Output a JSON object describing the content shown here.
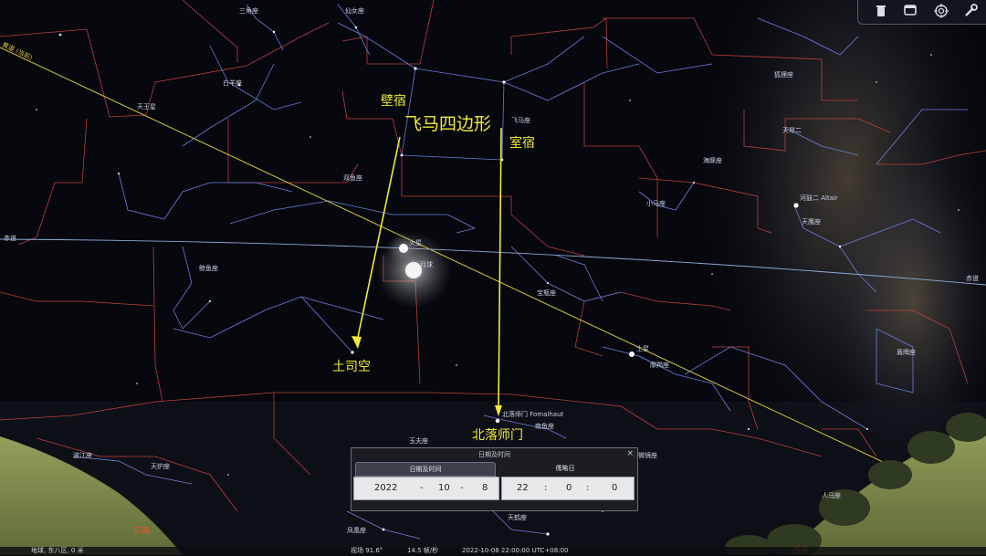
{
  "constellations": {
    "sanjiao": "三角座",
    "xiannv": "仙女座",
    "baiyang": "白羊座",
    "tianwang": "天王星",
    "shuangyu": "双鱼座",
    "jingyu": "鲸鱼座",
    "feima": "飞马座",
    "hutu": "狐狸座",
    "tianqin": "天琴二",
    "haitun": "海豚座",
    "xiaoma": "小马座",
    "altair": "河鼓二 Altair",
    "tianying": "天鹰座",
    "huoxing": "火星",
    "yueqiu": "月球",
    "baoping": "宝瓶座",
    "tuxing": "土星",
    "mojie": "摩羯座",
    "dunpai": "盾牌座",
    "fomalhaut": "北落师门 Fomalhaut",
    "nanyu": "南鱼座",
    "yutian": "玉夫座",
    "xianweijing": "显微镜座",
    "bojiang": "波江座",
    "tianlu": "天炉座",
    "tianhe": "天鹤座",
    "fenghuang": "凤凰座",
    "renma": "人马座"
  },
  "lines": {
    "ecliptic": "黄道 (当前)",
    "equator_left": "赤道",
    "equator_right": "赤道"
  },
  "annotations": {
    "bisu": "壁宿",
    "feima_square": "飞马四边形",
    "shisu": "室宿",
    "tusikong": "土司空",
    "beiluo": "北落师门"
  },
  "horizon": {
    "southeast": "东南",
    "southwest": "西南"
  },
  "toolbar": {
    "icons": [
      "trash-icon",
      "window-icon",
      "target-icon",
      "wrench-icon"
    ]
  },
  "datetime": {
    "title": "日期及时间",
    "tab_datetime": "日期及时间",
    "tab_jd": "儒略日",
    "year": "2022",
    "month": "10",
    "day": "8",
    "hour": "22",
    "minute": "0",
    "second": "0",
    "sep_date": "-",
    "sep_time": ":",
    "close": "×"
  },
  "status": {
    "location": "地球, 东八区, 0 米",
    "fov": "视场 91.6°",
    "fps": "14.5 帧/秒",
    "datetime": "2022-10-08 22:00:00 UTC+08:00"
  },
  "colors": {
    "accent_yellow": "#f2ea3a",
    "boundary": "#b8413c",
    "constellation_line": "#6a7fd8",
    "horizon_label": "#e5562c"
  }
}
